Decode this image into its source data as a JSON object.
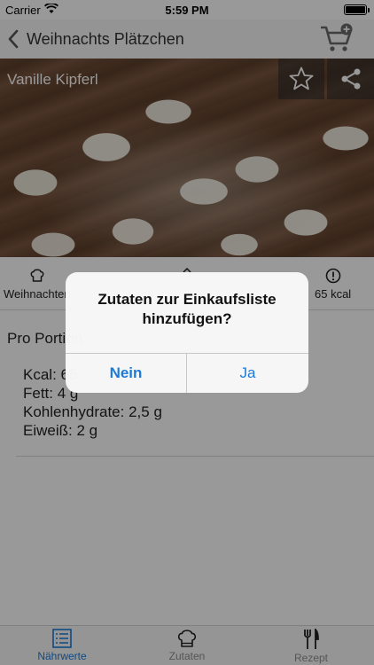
{
  "status_bar": {
    "carrier": "Carrier",
    "time": "5:59 PM"
  },
  "nav": {
    "back_label": "Weihnachts Plätzchen",
    "cart_icon": "cart-add-icon"
  },
  "hero": {
    "title": "Vanille Kipferl",
    "favorite_icon": "star-icon",
    "share_icon": "share-icon"
  },
  "info": {
    "category": "Weihnachten",
    "kcal": "65 kcal"
  },
  "nutrition": {
    "heading": "Pro Portion",
    "items": [
      "Kcal: 65",
      "Fett: 4 g",
      "Kohlenhydrate: 2,5 g",
      "Eiweiß: 2 g"
    ]
  },
  "tabs": [
    {
      "label": "Nährwerte",
      "icon": "list-icon",
      "active": true
    },
    {
      "label": "Zutaten",
      "icon": "chef-hat-icon",
      "active": false
    },
    {
      "label": "Rezept",
      "icon": "cutlery-icon",
      "active": false
    }
  ],
  "alert": {
    "title": "Zutaten zur Einkaufsliste hinzufügen?",
    "no_label": "Nein",
    "yes_label": "Ja"
  },
  "colors": {
    "accent": "#1d7ad6",
    "nav_bg": "#f7f7f7"
  }
}
